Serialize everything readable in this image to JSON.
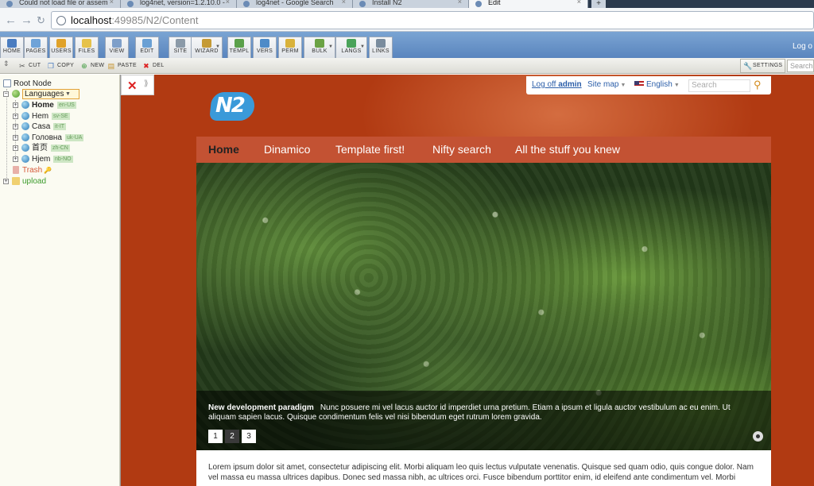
{
  "browser": {
    "tabs": [
      {
        "title": "Could not load file or assem",
        "active": false
      },
      {
        "title": "log4net, version=1.2.10.0 - ",
        "active": false
      },
      {
        "title": "log4net - Google Search",
        "active": false
      },
      {
        "title": "Install N2",
        "active": false
      },
      {
        "title": "Edit",
        "active": true
      }
    ],
    "new_tab_label": "+",
    "url_host": "localhost",
    "url_rest": ":49985/N2/Content"
  },
  "toolbar": {
    "buttons": [
      {
        "label": "HOME",
        "icon": "home-icon",
        "color": "#4a7cc0"
      },
      {
        "label": "PAGES",
        "icon": "pages-icon",
        "color": "#6fa3d8"
      },
      {
        "label": "USERS",
        "icon": "users-icon",
        "color": "#e0a22a"
      },
      {
        "label": "FILES",
        "icon": "folder-icon",
        "color": "#e6c24a"
      },
      {
        "label": "VIEW",
        "icon": "view-icon",
        "color": "#7e9fc9"
      },
      {
        "label": "EDIT",
        "icon": "edit-icon",
        "color": "#6aa0d4"
      },
      {
        "label": "SITE",
        "icon": "site-icon",
        "color": "#8b9aa8"
      },
      {
        "label": "WIZARD",
        "icon": "wizard-icon",
        "color": "#c59a35"
      },
      {
        "label": "TEMPL",
        "icon": "template-icon",
        "color": "#5aa04a"
      },
      {
        "label": "VERS",
        "icon": "versions-icon",
        "color": "#4e8bc8"
      },
      {
        "label": "PERM",
        "icon": "key-icon",
        "color": "#d9b23b"
      },
      {
        "label": "BULK",
        "icon": "bulk-icon",
        "color": "#6aa244"
      },
      {
        "label": "LANGS",
        "icon": "globe-icon",
        "color": "#4aa35a"
      },
      {
        "label": "LINKS",
        "icon": "links-icon",
        "color": "#7a8c9e"
      }
    ],
    "logoff": "Log o"
  },
  "actions": {
    "cut": "CUT",
    "copy": "COPY",
    "new": "NEW",
    "paste": "PASTE",
    "del": "DEL",
    "settings": "SETTINGS",
    "search_placeholder": "Search"
  },
  "tree": {
    "root": "Root Node",
    "languages": "Languages",
    "children": [
      {
        "label": "Home",
        "tag": "en-US",
        "bold": true
      },
      {
        "label": "Hem",
        "tag": "sv-SE",
        "bold": false
      },
      {
        "label": "Casa",
        "tag": "it-IT",
        "bold": false
      },
      {
        "label": "Головна",
        "tag": "uk-UA",
        "bold": false
      },
      {
        "label": "首页",
        "tag": "zh-CN",
        "bold": false
      },
      {
        "label": "Hjem",
        "tag": "nb-NO",
        "bold": false
      }
    ],
    "trash": "Trash",
    "upload": "upload"
  },
  "site": {
    "logo_text": "N2",
    "logoff_prefix": "Log off",
    "logoff_user": "admin",
    "sitemap": "Site map",
    "language": "English",
    "search_placeholder": "Search",
    "menu": [
      "Home",
      "Dinamico",
      "Template first!",
      "Nifty search",
      "All the stuff you knew"
    ],
    "caption_title": "New development paradigm",
    "caption_text": "Nunc posuere mi vel lacus auctor id imperdiet urna pretium. Etiam a ipsum et ligula auctor vestibulum ac eu enim. Ut aliquam sapien lacus. Quisque condimentum felis vel nisi bibendum eget rutrum lorem gravida.",
    "pager": [
      "1",
      "2",
      "3"
    ],
    "pager_active": "2",
    "body_text": "Lorem ipsum dolor sit amet, consectetur adipiscing elit. Morbi aliquam leo quis lectus vulputate venenatis. Quisque sed quam odio, quis congue dolor. Nam vel massa eu massa ultrices dapibus. Donec sed massa nibh, ac ultrices orci. Fusce bibendum porttitor enim, id eleifend ante condimentum vel. Morbi"
  }
}
